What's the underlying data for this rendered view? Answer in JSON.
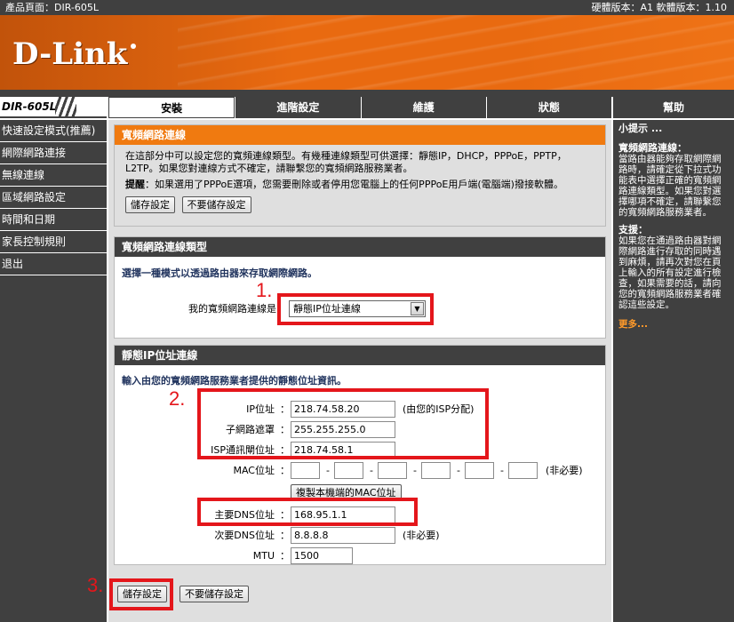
{
  "topbar": {
    "product": "產品頁面：DIR-605L",
    "version": "硬體版本：A1   軟體版本：1.10"
  },
  "brand": {
    "logo": "D-Link",
    "model": "DIR-605L"
  },
  "nav": {
    "tabs": [
      "安裝",
      "進階設定",
      "維護",
      "狀態"
    ],
    "help": "幫助"
  },
  "sidebar": {
    "items": [
      "快速設定模式(推薦)",
      "網際網路連接",
      "無線連線",
      "區域網路設定",
      "時間和日期",
      "家長控制規則",
      "退出"
    ]
  },
  "section1": {
    "title": "寬頻網路連線",
    "desc": "在這部分中可以設定您的寬頻連線類型。有幾種連線類型可供選擇：靜態IP，DHCP，PPPoE，PPTP，L2TP。如果您對連線方式不確定，請聯繫您的寬頻網路服務業者。",
    "note_label": "提醒",
    "note": "：如果選用了PPPoE選項，您需要刪除或者停用您電腦上的任何PPPoE用戶端(電腦端)撥接軟體。",
    "save": "儲存設定",
    "nosave": "不要儲存設定"
  },
  "section2": {
    "title": "寬頻網路連線類型",
    "subtitle": "選擇一種模式以透過路由器來存取網際網路。",
    "label": "我的寬頻網路連線是",
    "value": "靜態IP位址連線"
  },
  "section3": {
    "title": "靜態IP位址連線",
    "subtitle": "輸入由您的寬頻網路服務業者提供的靜態位址資訊。",
    "ip_label": "IP位址",
    "ip": "218.74.58.20",
    "ip_note": "(由您的ISP分配)",
    "mask_label": "子網路遮罩",
    "mask": "255.255.255.0",
    "gw_label": "ISP通訊閘位址",
    "gw": "218.74.58.1",
    "mac_label": "MAC位址",
    "mac_note": "(非必要)",
    "mac_button": "複製本機端的MAC位址",
    "dns1_label": "主要DNS位址",
    "dns1": "168.95.1.1",
    "dns2_label": "次要DNS位址",
    "dns2": "8.8.8.8",
    "dns2_note": "(非必要)",
    "mtu_label": "MTU",
    "mtu": "1500",
    "colon": "："
  },
  "footer": {
    "save": "儲存設定",
    "nosave": "不要儲存設定"
  },
  "help": {
    "title": "小提示 ...",
    "h1": "寬頻網路連線：",
    "p1": "當路由器能夠存取網際網路時，請確定從下拉式功能表中選擇正確的寬頻網路連線類型。如果您對選擇哪項不確定，請聯繫您的寬頻網路服務業者。",
    "h2": "支援：",
    "p2": "如果您在通過路由器對網際網路進行存取的同時遇到麻煩，請再次對您在頁上輸入的所有設定進行檢查，如果需要的話，請向您的寬頻網路服務業者確認這些設定。",
    "more": "更多..."
  },
  "annotations": {
    "one": "1.",
    "two": "2.",
    "three": "3."
  },
  "colors": {
    "accent": "#f07a10",
    "dark": "#404040",
    "annotation": "#e4161b"
  }
}
